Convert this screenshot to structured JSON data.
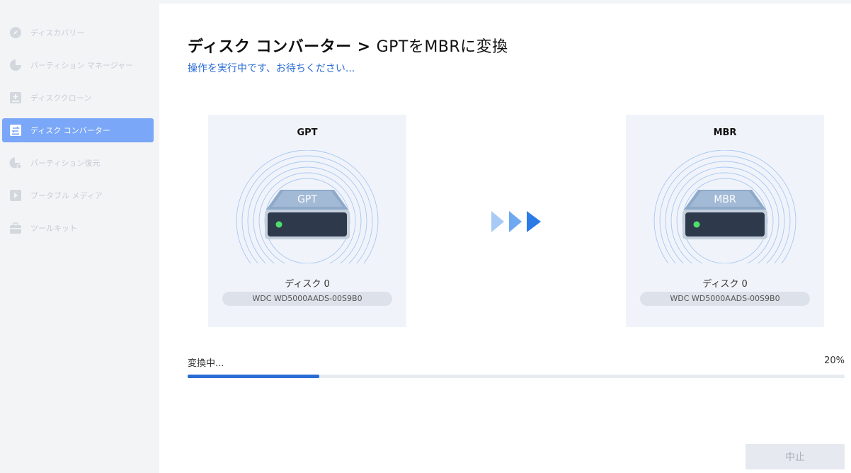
{
  "sidebar": {
    "items": [
      {
        "label": "ディスカバリー",
        "icon": "compass-icon",
        "active": false
      },
      {
        "label": "パーティション マネージャー",
        "icon": "pie-chart-icon",
        "active": false
      },
      {
        "label": "ディスククローン",
        "icon": "disk-clone-icon",
        "active": false
      },
      {
        "label": "ディスク コンバーター",
        "icon": "disk-convert-icon",
        "active": true
      },
      {
        "label": "パーティション復元",
        "icon": "partition-recovery-icon",
        "active": false
      },
      {
        "label": "ブータブル メディア",
        "icon": "bootable-media-icon",
        "active": false
      },
      {
        "label": "ツールキット",
        "icon": "toolkit-icon",
        "active": false
      }
    ]
  },
  "header": {
    "title_main": "ディスク コンバーター",
    "separator": ">",
    "title_sub": "GPTをMBRに変換",
    "status": "操作を実行中です、お待ちください..."
  },
  "source": {
    "title": "GPT",
    "disk_label": "GPT",
    "disk_name": "ディスク 0",
    "disk_model": "WDC WD5000AADS-00S9B0"
  },
  "target": {
    "title": "MBR",
    "disk_label": "MBR",
    "disk_name": "ディスク 0",
    "disk_model": "WDC WD5000AADS-00S9B0"
  },
  "progress": {
    "label": "変換中...",
    "percent_text": "20%",
    "value": 0.2
  },
  "buttons": {
    "stop": "中止"
  },
  "colors": {
    "accent": "#2a6cd4",
    "active_nav": "#7aa7f7"
  }
}
